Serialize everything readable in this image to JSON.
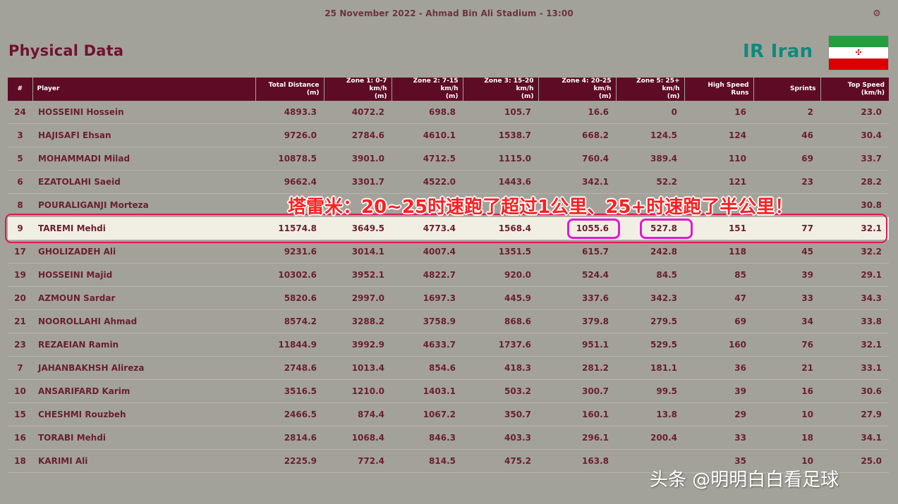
{
  "header": {
    "match_info": "25 November 2022 - Ahmad Bin Ali Stadium - 13:00",
    "corner_icon": "settings-gear-icon",
    "page_title": "Physical Data",
    "team_name": "IR Iran",
    "flag_colors": [
      "#239f40",
      "#ffffff",
      "#da0000"
    ]
  },
  "table": {
    "columns": [
      {
        "label": "#"
      },
      {
        "label": "Player"
      },
      {
        "label": "Total Distance",
        "unit": "(m)"
      },
      {
        "label": "Zone 1: 0-7 km/h",
        "unit": "(m)"
      },
      {
        "label": "Zone 2: 7-15 km/h",
        "unit": "(m)"
      },
      {
        "label": "Zone 3: 15-20 km/h",
        "unit": "(m)"
      },
      {
        "label": "Zone 4: 20-25 km/h",
        "unit": "(m)"
      },
      {
        "label": "Zone 5: 25+ km/h",
        "unit": "(m)"
      },
      {
        "label": "High Speed Runs"
      },
      {
        "label": "Sprints"
      },
      {
        "label": "Top Speed",
        "unit": "(km/h)"
      }
    ],
    "rows": [
      [
        "24",
        "HOSSEINI Hossein",
        "4893.3",
        "4072.2",
        "698.8",
        "105.7",
        "16.6",
        "0",
        "16",
        "2",
        "23.0"
      ],
      [
        "3",
        "HAJISAFI Ehsan",
        "9726.0",
        "2784.6",
        "4610.1",
        "1538.7",
        "668.2",
        "124.5",
        "124",
        "46",
        "30.4"
      ],
      [
        "5",
        "MOHAMMADI Milad",
        "10878.5",
        "3901.0",
        "4712.5",
        "1115.0",
        "760.4",
        "389.4",
        "110",
        "69",
        "33.7"
      ],
      [
        "6",
        "EZATOLAHI Saeid",
        "9662.4",
        "3301.7",
        "4522.0",
        "1443.6",
        "342.1",
        "52.2",
        "121",
        "23",
        "28.2"
      ],
      [
        "8",
        "POURALIGANJI Morteza",
        "",
        "",
        "",
        "",
        "",
        "",
        "",
        "",
        "30.8"
      ],
      [
        "9",
        "TAREMI Mehdi",
        "11574.8",
        "3649.5",
        "4773.4",
        "1568.4",
        "1055.6",
        "527.8",
        "151",
        "77",
        "32.1"
      ],
      [
        "17",
        "GHOLIZADEH Ali",
        "9231.6",
        "3014.1",
        "4007.4",
        "1351.5",
        "615.7",
        "242.8",
        "118",
        "45",
        "32.2"
      ],
      [
        "19",
        "HOSSEINI Majid",
        "10302.6",
        "3952.1",
        "4822.7",
        "920.0",
        "524.4",
        "84.5",
        "85",
        "39",
        "29.1"
      ],
      [
        "20",
        "AZMOUN Sardar",
        "5820.6",
        "2997.0",
        "1697.3",
        "445.9",
        "337.6",
        "342.3",
        "47",
        "33",
        "34.3"
      ],
      [
        "21",
        "NOOROLLAHI Ahmad",
        "8574.2",
        "3288.2",
        "3758.9",
        "868.6",
        "379.8",
        "279.5",
        "69",
        "34",
        "33.8"
      ],
      [
        "23",
        "REZAEIAN Ramin",
        "11844.9",
        "3992.9",
        "4633.7",
        "1737.6",
        "951.1",
        "529.5",
        "160",
        "76",
        "32.1"
      ],
      [
        "7",
        "JAHANBAKHSH Alireza",
        "2748.6",
        "1013.4",
        "854.6",
        "418.3",
        "281.2",
        "181.1",
        "36",
        "21",
        "33.1"
      ],
      [
        "10",
        "ANSARIFARD Karim",
        "3516.5",
        "1210.0",
        "1403.1",
        "503.2",
        "300.7",
        "99.5",
        "39",
        "16",
        "30.6"
      ],
      [
        "15",
        "CHESHMI Rouzbeh",
        "2466.5",
        "874.4",
        "1067.2",
        "350.7",
        "160.1",
        "13.8",
        "29",
        "10",
        "27.9"
      ],
      [
        "16",
        "TORABI Mehdi",
        "2814.6",
        "1068.4",
        "846.3",
        "403.3",
        "296.1",
        "200.4",
        "33",
        "18",
        "34.1"
      ],
      [
        "18",
        "KARIMI Ali",
        "2225.9",
        "772.4",
        "814.5",
        "475.2",
        "163.8",
        "",
        "35",
        "10",
        "25.0"
      ]
    ],
    "highlighted_row": 5
  },
  "overlay": {
    "caption": "塔雷米：20~25时速跑了超过1公里、25+时速跑了半公里！",
    "highlight_color": "#e0185a",
    "pill_color": "#e01ad0"
  },
  "watermark": "头条 @明明白白看足球"
}
